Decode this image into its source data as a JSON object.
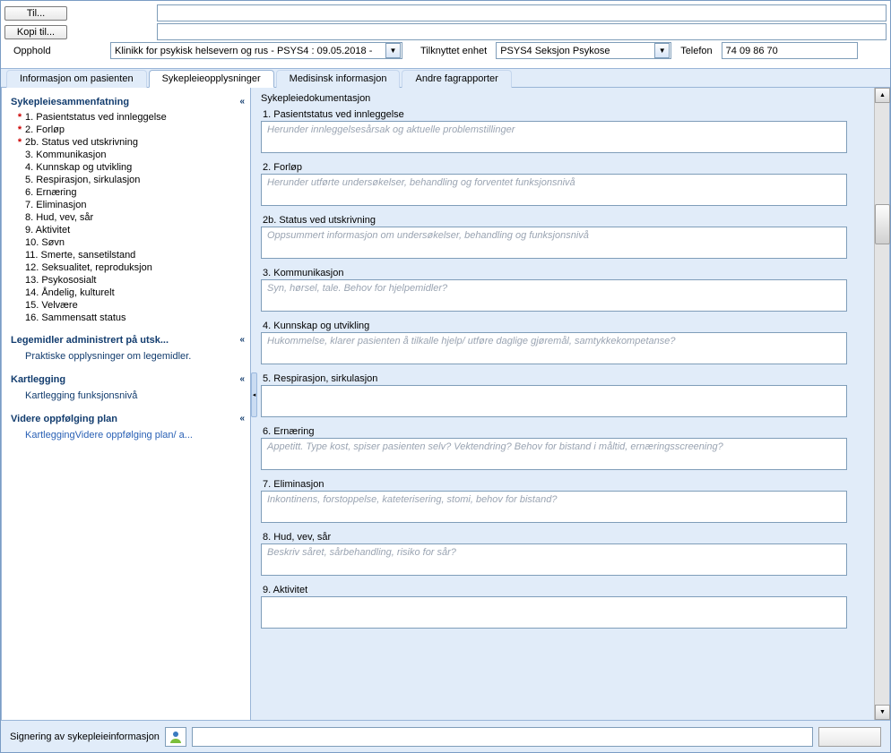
{
  "top": {
    "to_label": "Til...",
    "copy_label": "Kopi til...",
    "opphold_label": "Opphold",
    "opphold_value": "Klinikk for psykisk helsevern og rus - PSYS4 : 09.05.2018 -",
    "enhet_label": "Tilknyttet enhet",
    "enhet_value": "PSYS4 Seksjon Psykose",
    "telefon_label": "Telefon",
    "telefon_value": "74 09 86 70"
  },
  "tabs": {
    "t1": "Informasjon om pasienten",
    "t2": "Sykepleieopplysninger",
    "t3": "Medisinsk informasjon",
    "t4": "Andre fagrapporter"
  },
  "sidebar": {
    "g1_header": "Sykepleiesammenfatning",
    "items": [
      {
        "num": "1.",
        "label": "Pasientstatus ved innleggelse",
        "req": true
      },
      {
        "num": "2.",
        "label": "Forløp",
        "req": true
      },
      {
        "num": "2b.",
        "label": "Status ved utskrivning",
        "req": true
      },
      {
        "num": "3.",
        "label": "Kommunikasjon",
        "req": false
      },
      {
        "num": "4.",
        "label": "Kunnskap og utvikling",
        "req": false
      },
      {
        "num": "5.",
        "label": "Respirasjon, sirkulasjon",
        "req": false
      },
      {
        "num": "6.",
        "label": "Ernæring",
        "req": false
      },
      {
        "num": "7.",
        "label": "Eliminasjon",
        "req": false
      },
      {
        "num": "8.",
        "label": "Hud, vev, sår",
        "req": false
      },
      {
        "num": "9.",
        "label": "Aktivitet",
        "req": false
      },
      {
        "num": "10.",
        "label": "Søvn",
        "req": false
      },
      {
        "num": "11.",
        "label": "Smerte, sansetilstand",
        "req": false
      },
      {
        "num": "12.",
        "label": "Seksualitet, reproduksjon",
        "req": false
      },
      {
        "num": "13.",
        "label": "Psykososialt",
        "req": false
      },
      {
        "num": "14.",
        "label": "Åndelig, kulturelt",
        "req": false
      },
      {
        "num": "15.",
        "label": "Velvære",
        "req": false
      },
      {
        "num": "16.",
        "label": "Sammensatt status",
        "req": false
      }
    ],
    "g2_header": "Legemidler administrert på utsk...",
    "g2_item": "Praktiske opplysninger om legemidler.",
    "g3_header": "Kartlegging",
    "g3_item": "Kartlegging funksjonsnivå",
    "g4_header": "Videre oppfølging plan",
    "g4_item": "KartleggingVidere oppfølging plan/ a..."
  },
  "form": {
    "title": "Sykepleiedokumentasjon",
    "sections": [
      {
        "label": "1. Pasientstatus ved innleggelse",
        "placeholder": "Herunder innleggelsesårsak og aktuelle problemstillinger"
      },
      {
        "label": "2. Forløp",
        "placeholder": "Herunder utførte undersøkelser, behandling og forventet funksjonsnivå"
      },
      {
        "label": "2b. Status ved utskrivning",
        "placeholder": "Oppsummert informasjon om undersøkelser, behandling og funksjonsnivå"
      },
      {
        "label": "3. Kommunikasjon",
        "placeholder": "Syn, hørsel, tale. Behov for hjelpemidler?"
      },
      {
        "label": "4. Kunnskap og utvikling",
        "placeholder": "Hukommelse, klarer pasienten å tilkalle hjelp/ utføre daglige gjøremål, samtykkekompetanse?"
      },
      {
        "label": "5. Respirasjon, sirkulasjon",
        "placeholder": ""
      },
      {
        "label": "6. Ernæring",
        "placeholder": "Appetitt. Type kost, spiser pasienten selv? Vektendring? Behov for bistand i måltid, ernæringsscreening?"
      },
      {
        "label": "7. Eliminasjon",
        "placeholder": "Inkontinens, forstoppelse, kateterisering, stomi, behov for bistand?"
      },
      {
        "label": "8. Hud, vev, sår",
        "placeholder": "Beskriv såret, sårbehandling, risiko for sår?"
      },
      {
        "label": "9. Aktivitet",
        "placeholder": ""
      }
    ]
  },
  "bottom": {
    "sign_label": "Signering av sykepleieinformasjon"
  }
}
